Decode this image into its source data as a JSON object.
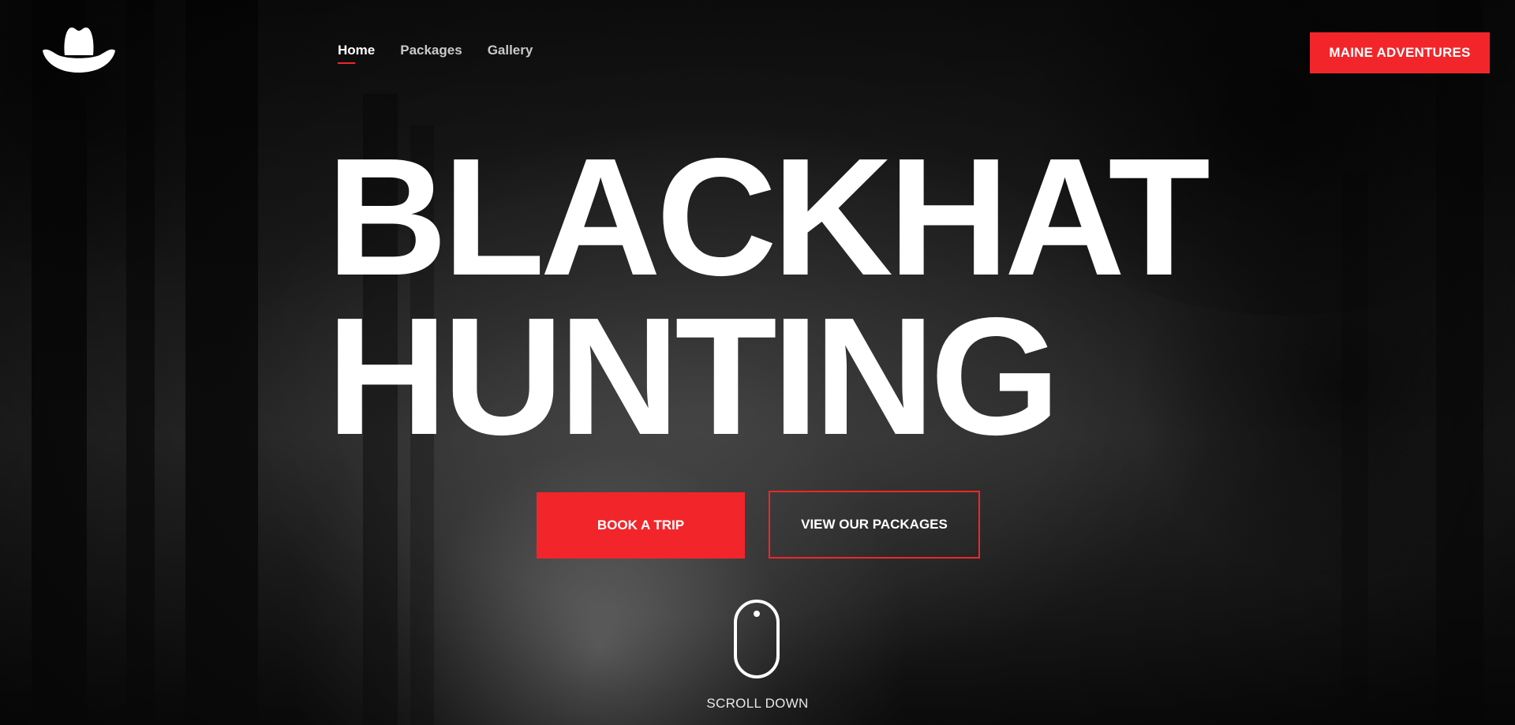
{
  "brand": {
    "logo_icon": "cowboy-hat-icon"
  },
  "nav": {
    "items": [
      {
        "label": "Home",
        "active": true
      },
      {
        "label": "Packages",
        "active": false
      },
      {
        "label": "Gallery",
        "active": false
      }
    ]
  },
  "header": {
    "cta_label": "MAINE ADVENTURES"
  },
  "hero": {
    "title_line1": "BLACKHAT",
    "title_line2": "HUNTING",
    "primary_button": "BOOK A TRIP",
    "secondary_button": "VIEW OUR PACKAGES",
    "scroll_label": "SCROLL DOWN",
    "scroll_icon": "mouse-icon"
  },
  "colors": {
    "accent": "#f2262a",
    "text": "#ffffff",
    "nav_inactive": "#c9c9c9"
  }
}
